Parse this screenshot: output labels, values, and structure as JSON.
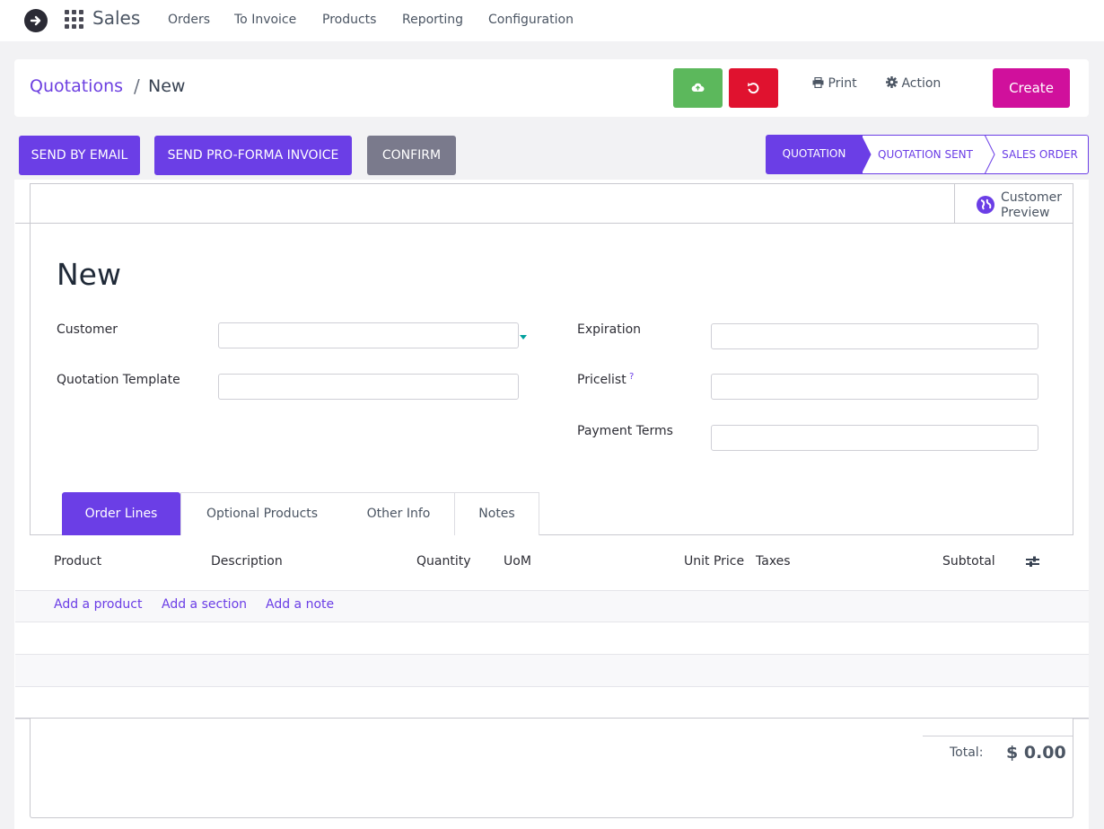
{
  "topbar": {
    "app_name": "Sales",
    "menu": [
      "Orders",
      "To Invoice",
      "Products",
      "Reporting",
      "Configuration"
    ]
  },
  "breadcrumb": {
    "parent": "Quotations",
    "separator": "/",
    "current": "New"
  },
  "toolbar": {
    "print_label": "Print",
    "action_label": "Action",
    "create_label": "Create"
  },
  "header_buttons": {
    "send_email": "SEND BY EMAIL",
    "send_proforma": "SEND PRO-FORMA INVOICE",
    "confirm": "CONFIRM"
  },
  "status_stages": [
    "QUOTATION",
    "QUOTATION SENT",
    "SALES ORDER"
  ],
  "preview_button": {
    "line1": "Customer",
    "line2": "Preview"
  },
  "form": {
    "title": "New",
    "customer_label": "Customer",
    "customer_value": "",
    "template_label": "Quotation Template",
    "template_value": "",
    "expiration_label": "Expiration",
    "expiration_value": "",
    "pricelist_label": "Pricelist",
    "pricelist_help": "?",
    "pricelist_value": "",
    "payment_terms_label": "Payment Terms",
    "payment_terms_value": ""
  },
  "tabs": [
    "Order Lines",
    "Optional Products",
    "Other Info",
    "Notes"
  ],
  "table": {
    "headers": [
      "Product",
      "Description",
      "Quantity",
      "UoM",
      "Unit Price",
      "Taxes",
      "Subtotal"
    ],
    "add_links": [
      "Add a product",
      "Add a section",
      "Add a note"
    ]
  },
  "totals": {
    "label": "Total:",
    "value": "$ 0.00"
  },
  "colors": {
    "primary": "#6b3ee6",
    "save": "#5cb85c",
    "discard": "#e0122f",
    "create": "#d0109c",
    "confirm": "#7a7a8c"
  }
}
